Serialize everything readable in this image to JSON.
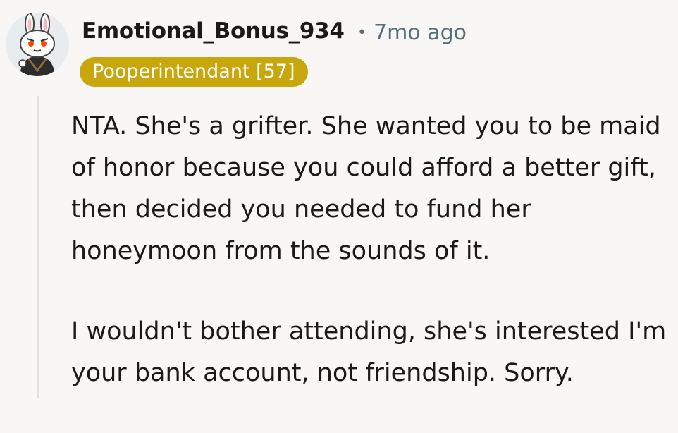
{
  "comment": {
    "username": "Emotional_Bonus_934",
    "separator": "•",
    "timestamp": "7mo ago",
    "flair": "Pooperintendant [57]",
    "avatar_icon": "snoo-bunny-avatar-icon",
    "paragraphs": [
      "NTA. She's a grifter. She wanted you to be maid of honor because you could afford a better gift, then decided you needed to fund her honeymoon from the sounds of it.",
      "I wouldn't bother attending, she's interested I'm your bank account, not friendship. Sorry."
    ]
  },
  "colors": {
    "background": "#f9f7f5",
    "flair_background": "#c8a70d",
    "meta_text": "#576f76",
    "thread_line": "#e0e2e4"
  }
}
